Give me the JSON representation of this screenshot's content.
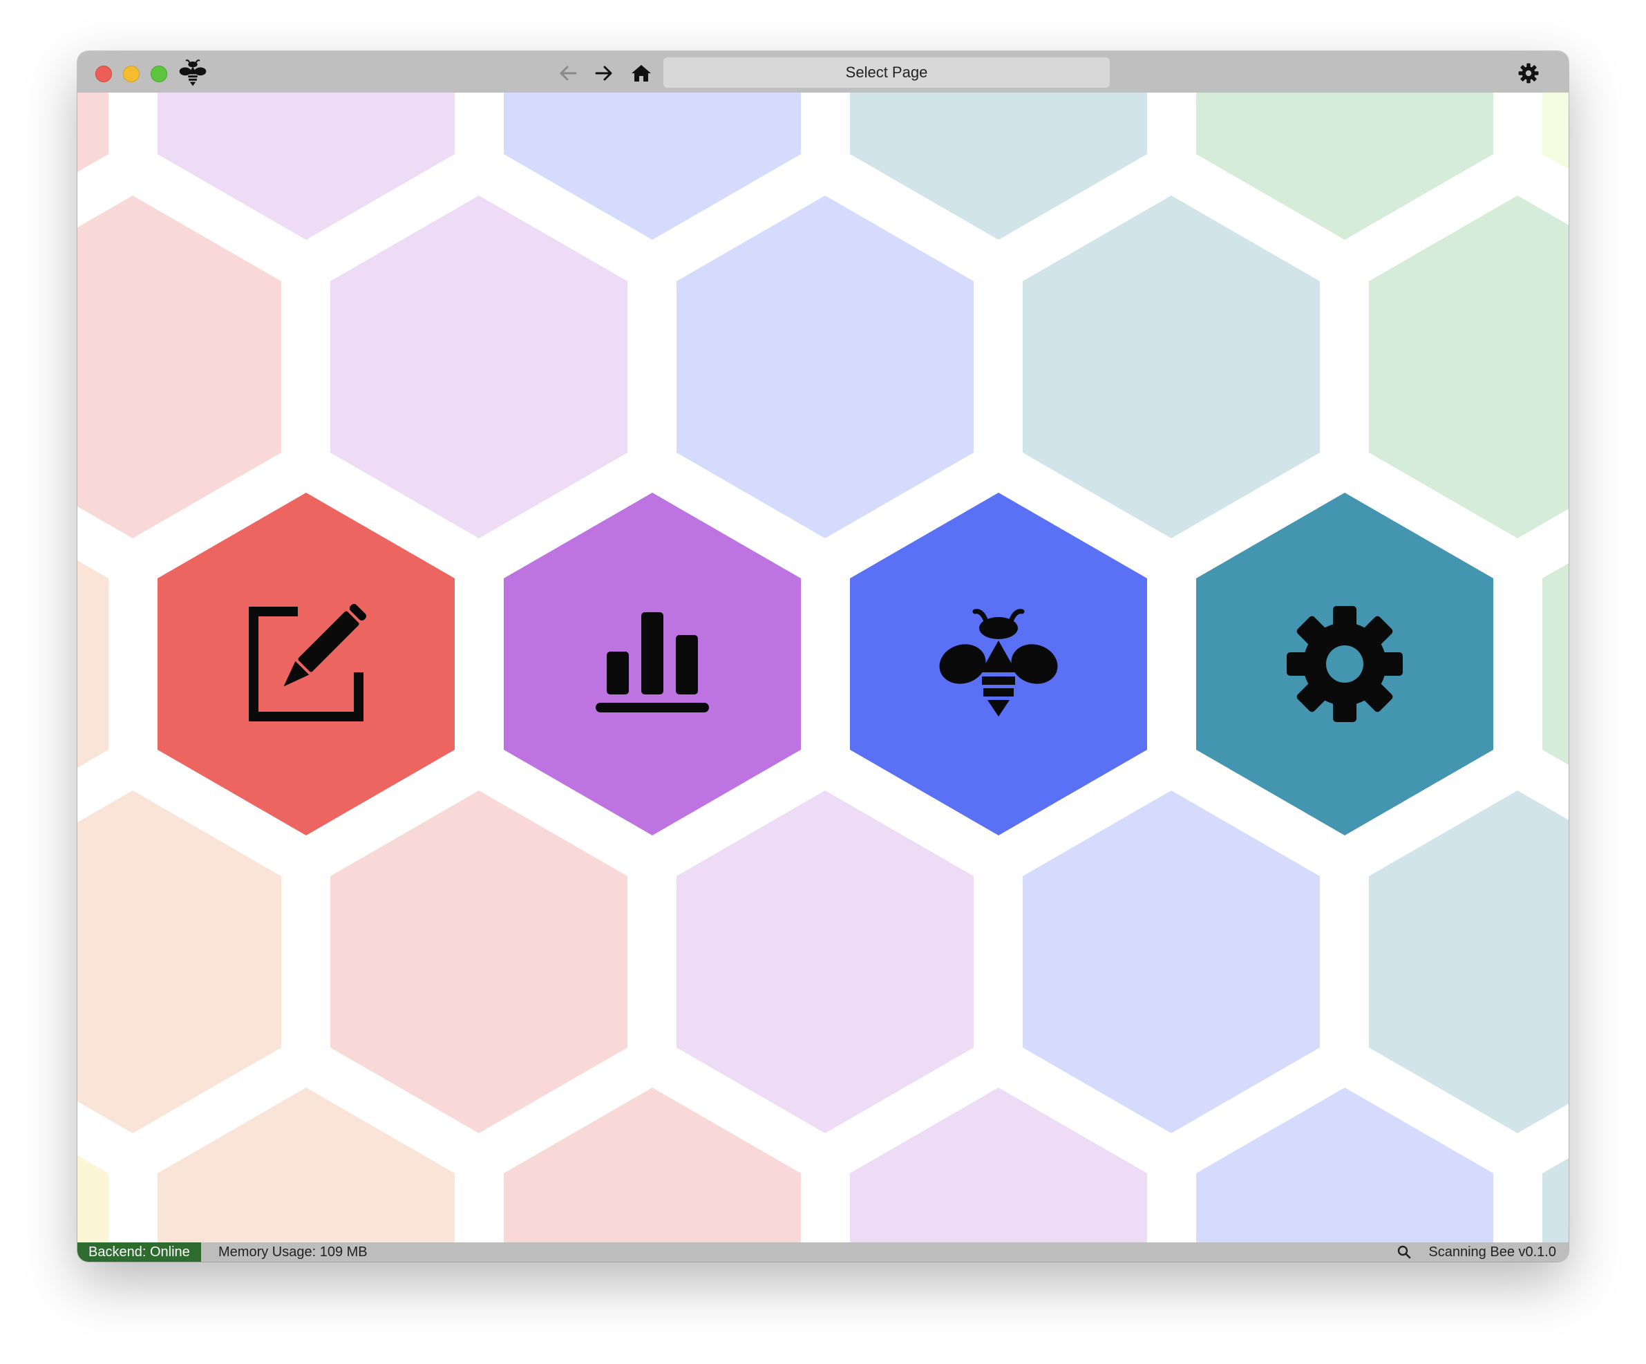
{
  "titlebar": {
    "page_select_label": "Select Page",
    "icons": [
      "bee-app-icon",
      "back-arrow-icon",
      "forward-arrow-icon",
      "home-icon",
      "gear-icon"
    ]
  },
  "tiles": [
    {
      "name": "edit",
      "icon": "edit-icon",
      "color": "#ec6560"
    },
    {
      "name": "statistics",
      "icon": "bar-chart-icon",
      "color": "#bd73e0"
    },
    {
      "name": "bee",
      "icon": "bee-icon",
      "color": "#5a70f5"
    },
    {
      "name": "settings",
      "icon": "gear-icon",
      "color": "#4395b0"
    }
  ],
  "background_colors": {
    "red": "#f8d9d7",
    "purple": "#eedbf6",
    "blue": "#d5dbfc",
    "teal": "#d0e4ea",
    "green": "#d5ecd8",
    "orange": "#fae4d8",
    "yellow": "#fdf6d6",
    "lime": "#f3fbe0"
  },
  "statusbar": {
    "backend": "Backend: Online",
    "memory": "Memory Usage: 109 MB",
    "version": "Scanning Bee v0.1.0",
    "backend_color": "#2e6b2e"
  }
}
